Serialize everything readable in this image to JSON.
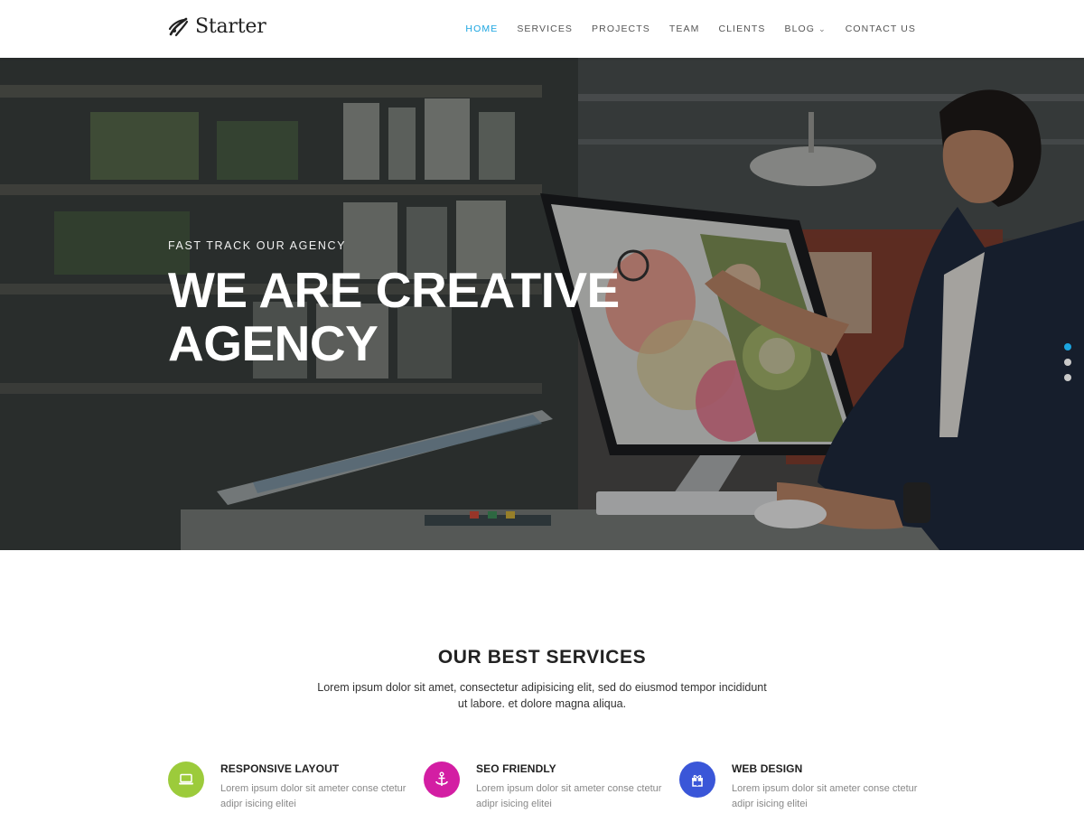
{
  "brand": {
    "name": "Starter",
    "logo_icon": "rocket-swirl-icon"
  },
  "nav": {
    "items": [
      {
        "label": "HOME",
        "active": true
      },
      {
        "label": "SERVICES",
        "active": false
      },
      {
        "label": "PROJECTS",
        "active": false
      },
      {
        "label": "TEAM",
        "active": false
      },
      {
        "label": "CLIENTS",
        "active": false
      },
      {
        "label": "BLOG",
        "active": false,
        "has_dropdown": true
      },
      {
        "label": "CONTACT US",
        "active": false
      }
    ]
  },
  "hero": {
    "kicker": "FAST TRACK OUR AGENCY",
    "headline": "WE ARE CREATIVE AGENCY",
    "slides_total": 3,
    "active_slide": 1
  },
  "services": {
    "title": "OUR BEST SERVICES",
    "description": "Lorem ipsum dolor sit amet, consectetur adipisicing elit, sed do eiusmod tempor incididunt ut labore. et dolore magna aliqua.",
    "items": [
      {
        "title": "RESPONSIVE LAYOUT",
        "text": "Lorem ipsum dolor sit ameter conse ctetur adipr isicing elitei",
        "icon": "laptop-icon",
        "color": "#9ccb3b"
      },
      {
        "title": "SEO FRIENDLY",
        "text": "Lorem ipsum dolor sit ameter conse ctetur adipr isicing elitei",
        "icon": "anchor-icon",
        "color": "#d31ea3"
      },
      {
        "title": "WEB DESIGN",
        "text": "Lorem ipsum dolor sit ameter conse ctetur adipr isicing elitei",
        "icon": "gift-icon",
        "color": "#3a56d8"
      }
    ]
  },
  "colors": {
    "accent": "#1ba5e0",
    "text": "#222222",
    "muted": "#888888"
  }
}
